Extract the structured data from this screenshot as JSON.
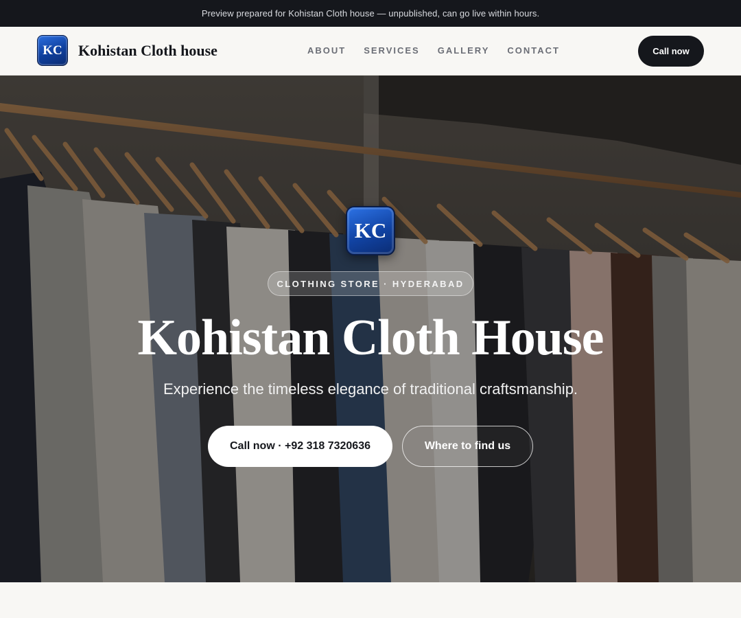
{
  "topbar": {
    "notice": "Preview prepared for Kohistan Cloth house — unpublished, can go live within hours."
  },
  "nav": {
    "brand_initials": "KC",
    "brand_name": "Kohistan Cloth house",
    "links": [
      "ABOUT",
      "SERVICES",
      "GALLERY",
      "CONTACT"
    ],
    "cta_label": "Call now"
  },
  "hero": {
    "badge_initials": "KC",
    "pill": "CLOTHING STORE · HYDERABAD",
    "title": "Kohistan Cloth House",
    "subtitle": "Experience the timeless elegance of traditional craftsmanship.",
    "primary_cta": "Call now · +92 318 7320636",
    "secondary_cta": "Where to find us",
    "background_image": "clothes-on-hangers-photo"
  },
  "colors": {
    "dark": "#15171c",
    "page_bg": "#f8f7f4",
    "badge_blue": "#1143a3"
  }
}
